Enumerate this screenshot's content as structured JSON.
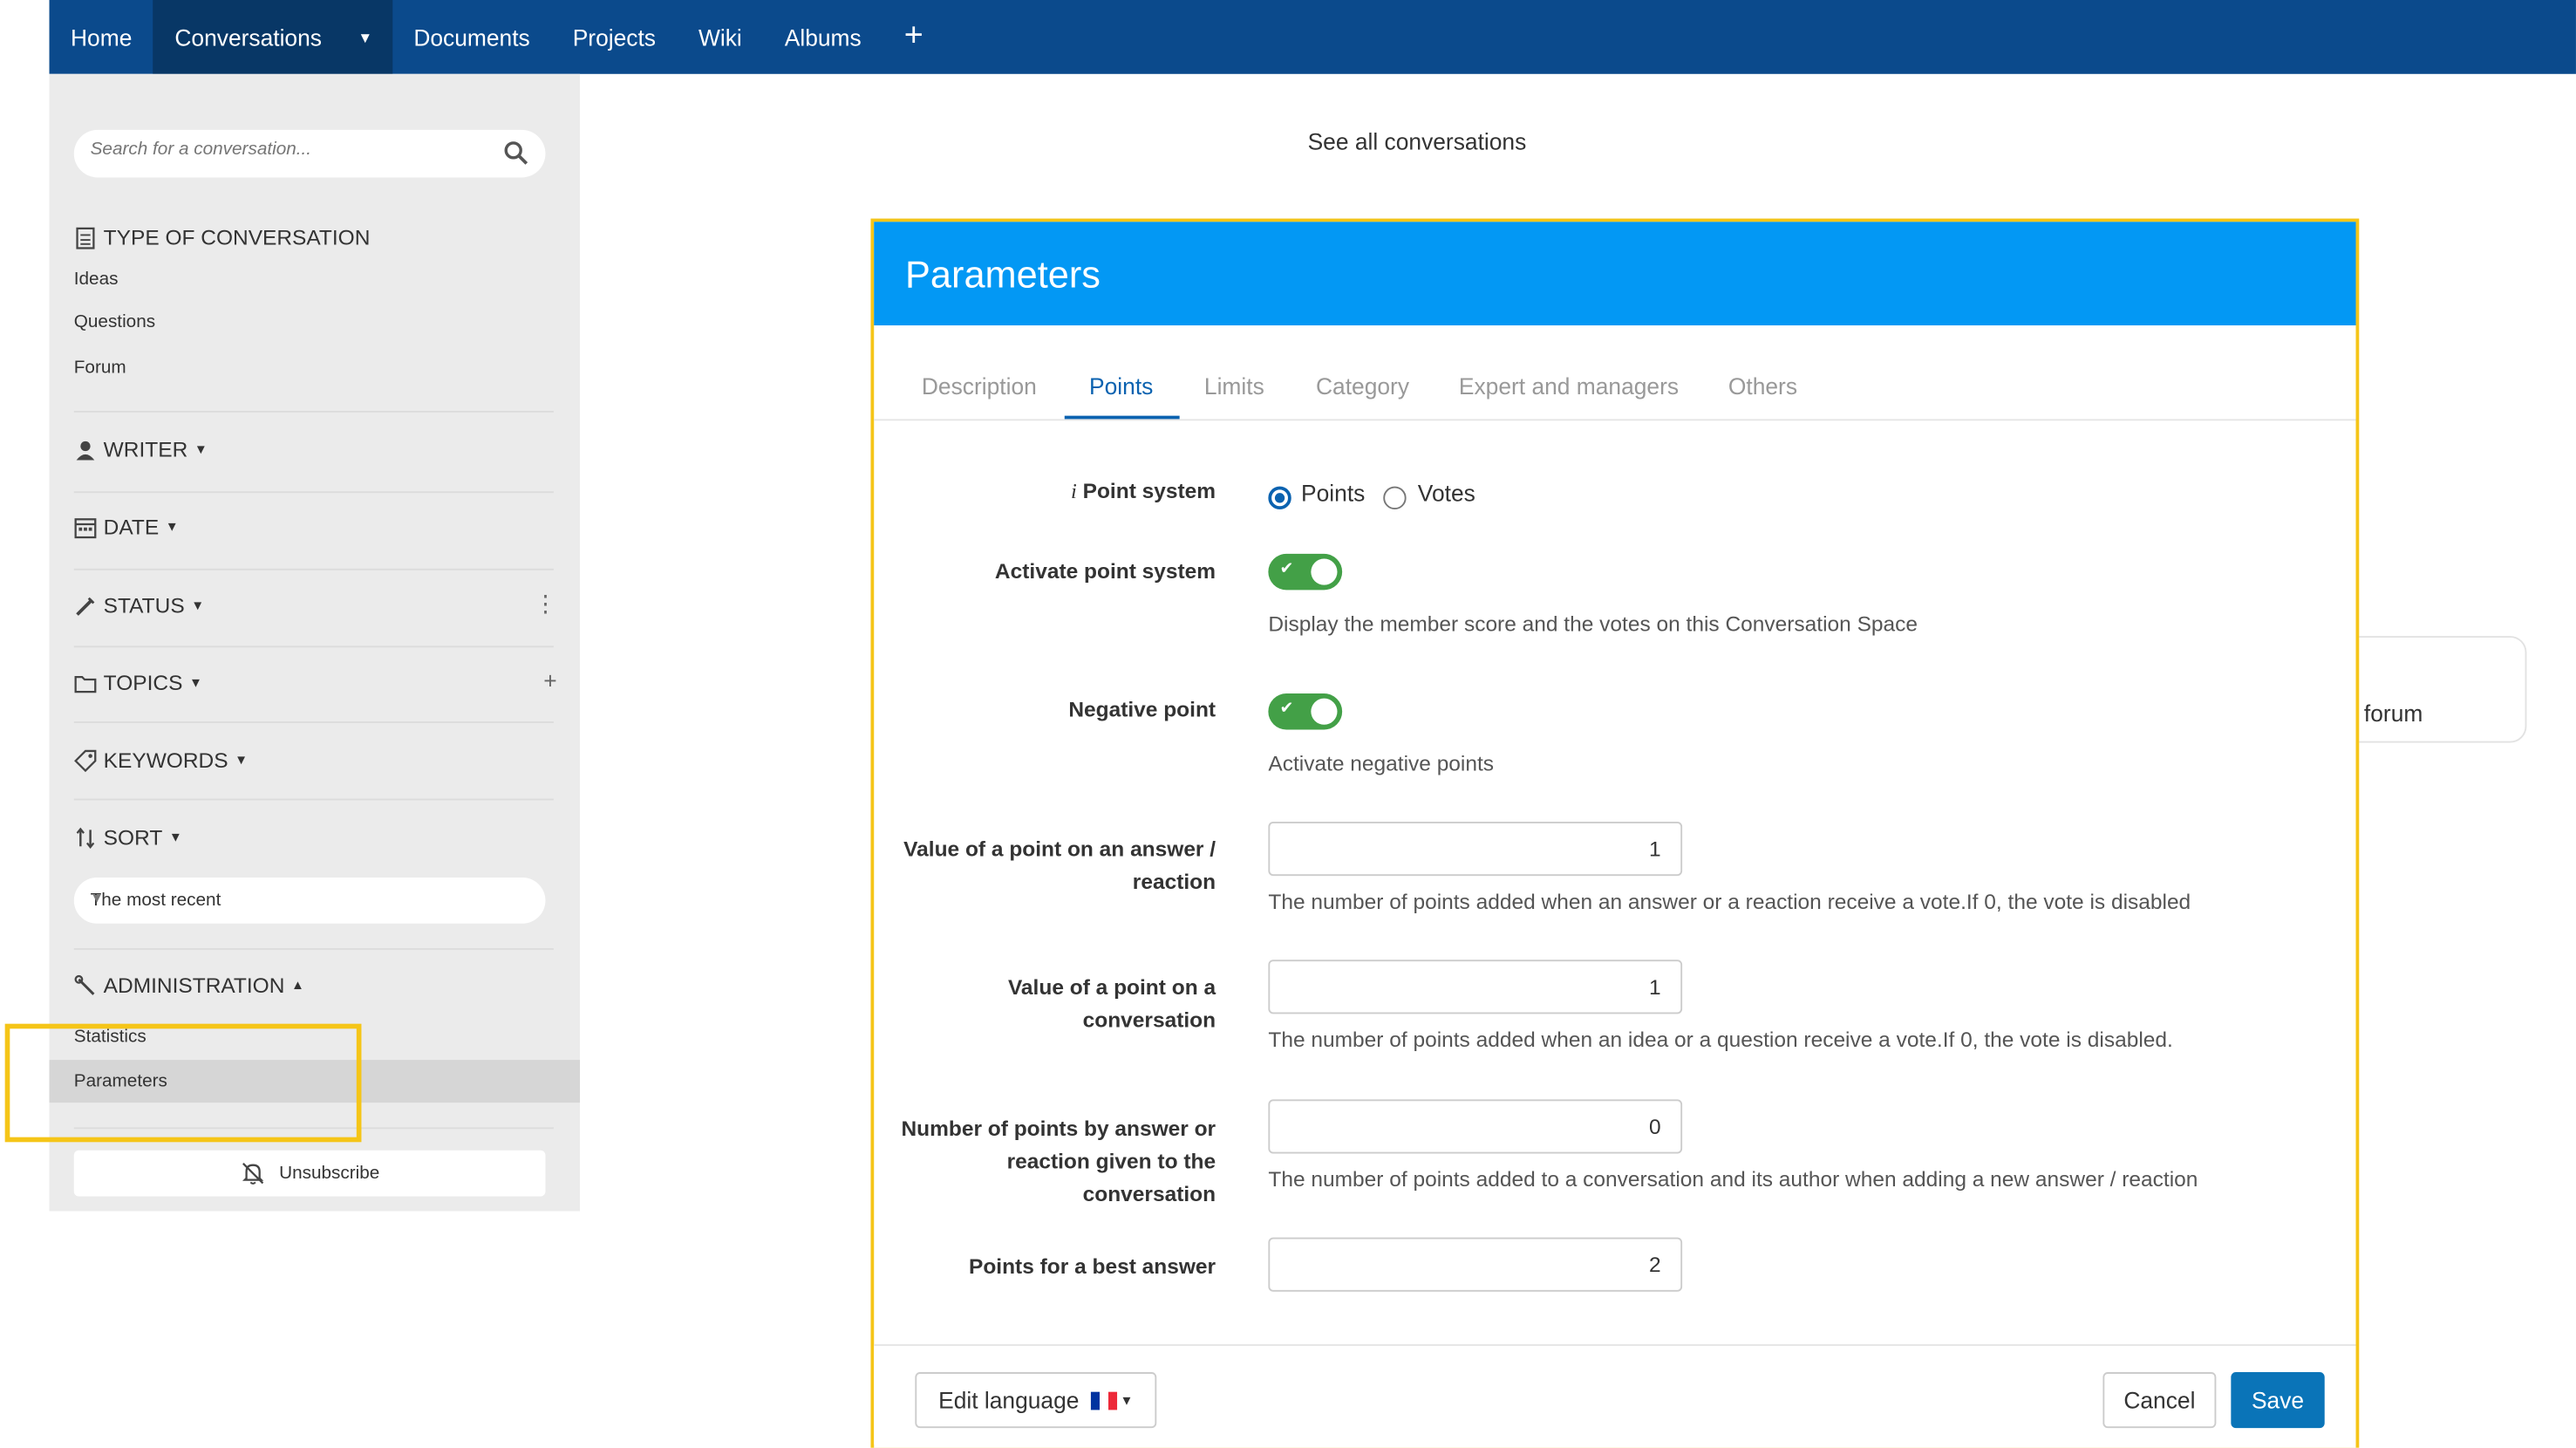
{
  "nav": {
    "items": [
      "Home",
      "Conversations",
      "Documents",
      "Projects",
      "Wiki",
      "Albums"
    ],
    "active": "Conversations",
    "plus": "+"
  },
  "sidebar": {
    "search_placeholder": "Search for a conversation...",
    "type_heading": "TYPE OF CONVERSATION",
    "types": [
      "Ideas",
      "Questions",
      "Forum"
    ],
    "writer": "WRITER",
    "date": "DATE",
    "status": "STATUS",
    "topics": "TOPICS",
    "keywords": "KEYWORDS",
    "sort": "SORT",
    "sort_value": "The most recent",
    "administration": "ADMINISTRATION",
    "admin_items": [
      "Statistics",
      "Parameters"
    ],
    "unsubscribe": "Unsubscribe"
  },
  "main": {
    "see_all": "See all conversations",
    "background_card": "forum"
  },
  "modal": {
    "title": "Parameters",
    "tabs": [
      "Description",
      "Points",
      "Limits",
      "Category",
      "Expert and managers",
      "Others"
    ],
    "active_tab": "Points",
    "point_system_label": "Point system",
    "point_system_options": [
      "Points",
      "Votes"
    ],
    "point_system_selected": "Points",
    "activate_label": "Activate point system",
    "activate_help": "Display the member score and the votes on this Conversation Space",
    "activate_on": true,
    "negative_label": "Negative point",
    "negative_help": "Activate negative points",
    "negative_on": true,
    "answer_value_label": "Value of a point on an answer / reaction",
    "answer_value": "1",
    "answer_value_help": "The number of points added when an answer or a reaction receive a vote.If 0, the vote is disabled",
    "conversation_value_label": "Value of a point on a conversation",
    "conversation_value": "1",
    "conversation_value_help": "The number of points added when an idea or a question receive a vote.If 0, the vote is disabled.",
    "points_by_answer_label": "Number of points by answer or reaction given to the conversation",
    "points_by_answer": "0",
    "points_by_answer_help": "The number of points added to a conversation and its author when adding a new answer / reaction",
    "best_answer_label": "Points for a best answer",
    "best_answer": "2",
    "edit_language": "Edit language",
    "cancel": "Cancel",
    "save": "Save"
  },
  "colors": {
    "nav_bg": "#0b4a8c",
    "modal_header": "#0398f4",
    "toggle_on": "#43a047",
    "save_button": "#0a74b8",
    "highlight": "#f5c518"
  }
}
